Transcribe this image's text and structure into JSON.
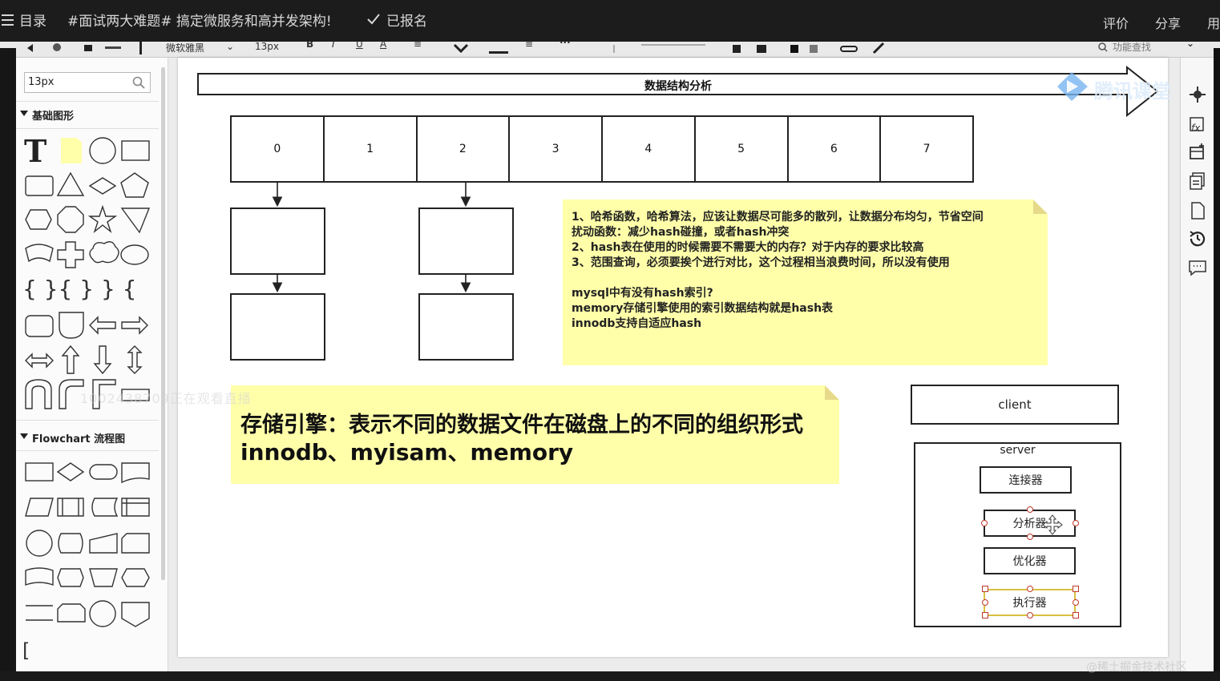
{
  "topbar": {
    "menu_icon": "menu-icon",
    "toc_label": "目录",
    "course_title": "#面试两大难题# 搞定微服务和高并发架构!",
    "check_icon": "check-icon",
    "registered_label": "已报名",
    "rate_label": "评价",
    "share_label": "分享",
    "use_label": "用"
  },
  "toolbar": {
    "font_family": "微软雅黑",
    "font_size": "13px",
    "search_placeholder": "功能查找"
  },
  "sidebar": {
    "search_value": "13px",
    "section_basic": "基础图形",
    "section_flowchart": "Flowchart 流程图"
  },
  "watermark": {
    "logo_text": "腾讯课堂",
    "viewer_text": "1002438709正在观看直播",
    "bottom_text": "@稀土掘金技术社区"
  },
  "diagram": {
    "title": "数据结构分析",
    "cells": [
      "0",
      "1",
      "2",
      "3",
      "4",
      "5",
      "6",
      "7"
    ],
    "note1": {
      "line1": "1、哈希函数，哈希算法，应该让数据尽可能多的散列，让数据分布均匀，节省空间",
      "line2": "扰动函数：减少hash碰撞，或者hash冲突",
      "line3": "2、hash表在使用的时候需要不需要大的内存？对于内存的要求比较高",
      "line4": "3、范围查询，必须要挨个进行对比，这个过程相当浪费时间，所以没有使用",
      "line5": "mysql中有没有hash索引?",
      "line6": "memory存储引擎使用的索引数据结构就是hash表",
      "line7": "innodb支持自适应hash"
    },
    "note2": {
      "title": "存储引擎：表示不同的数据文件在磁盘上的不同的组织形式",
      "subtitle": "innodb、myisam、memory"
    },
    "client_label": "client",
    "server_label": "server",
    "server_components": [
      "连接器",
      "分析器",
      "优化器",
      "执行器"
    ],
    "note_color": "#ffffaa"
  }
}
